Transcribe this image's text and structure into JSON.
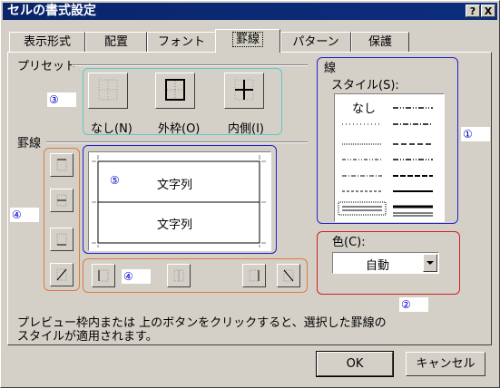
{
  "window": {
    "title": "セルの書式設定",
    "help_label": "?",
    "close_label": "X"
  },
  "tabs": [
    {
      "label": "表示形式"
    },
    {
      "label": "配置"
    },
    {
      "label": "フォント"
    },
    {
      "label": "罫線",
      "active": true
    },
    {
      "label": "パターン"
    },
    {
      "label": "保護"
    }
  ],
  "presets": {
    "group_label": "プリセット",
    "buttons": [
      {
        "label": "なし(N)"
      },
      {
        "label": "外枠(O)"
      },
      {
        "label": "内側(I)"
      }
    ]
  },
  "border": {
    "group_label": "罫線",
    "preview_texts": [
      "文字列",
      "文字列"
    ]
  },
  "line": {
    "group_label": "線",
    "style_label": "スタイル(S):",
    "none_label": "なし",
    "color_label": "色(C):",
    "color_value": "自動"
  },
  "markers": [
    "③",
    "①",
    "④",
    "⑤",
    "④",
    "②"
  ],
  "highlight_colors": {
    "cyan": "#5ec8c8",
    "orange": "#e07a3c",
    "blue": "#2222cc",
    "red": "#d02020"
  },
  "hint_text": [
    "プレビュー枠内または 上のボタンをクリックすると、選択した罫線の",
    "スタイルが適用されます。"
  ],
  "footer": {
    "ok_label": "OK",
    "cancel_label": "キャンセル"
  }
}
